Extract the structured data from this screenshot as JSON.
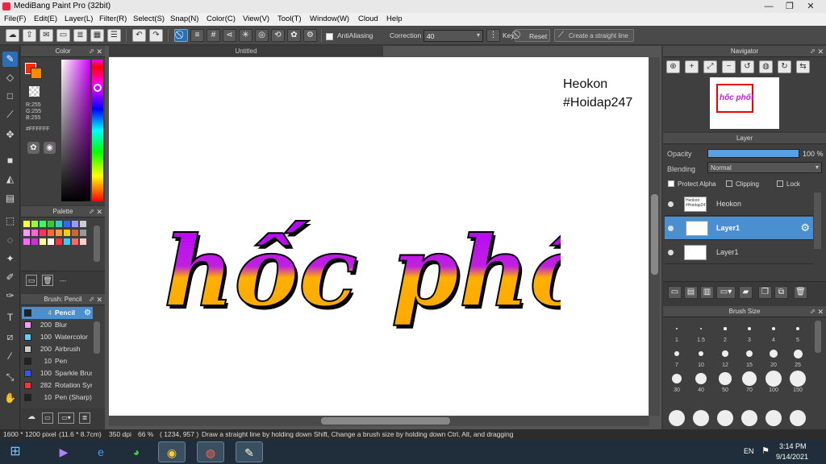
{
  "window": {
    "title": "MediBang Paint Pro (32bit)"
  },
  "menu": [
    "File(F)",
    "Edit(E)",
    "Layer(L)",
    "Filter(R)",
    "Select(S)",
    "Snap(N)",
    "Color(C)",
    "View(V)",
    "Tool(T)",
    "Window(W)",
    "Cloud",
    "Help"
  ],
  "toolbar": {
    "antialiasing_label": "AntiAliasing",
    "correction_label": "Correction",
    "correction_value": "40",
    "key_label": "Key",
    "reset_label": "Reset",
    "straight_line_label": "Create a straight line"
  },
  "color_panel": {
    "title": "Color",
    "r": "R:255",
    "g": "G:255",
    "b": "B:255",
    "hex": "#FFFFFF"
  },
  "palette_panel": {
    "title": "Palette",
    "footer": "---",
    "colors": [
      "#ffff33",
      "#99ff33",
      "#33ff66",
      "#33cc33",
      "#33cccc",
      "#3366ff",
      "#9999ff",
      "#cccccc",
      "#ff99ff",
      "#ff66cc",
      "#ff3366",
      "#ff6633",
      "#ff9933",
      "#ffcc00",
      "#cc6633",
      "#999999",
      "#ff66ff",
      "#cc33cc",
      "#ffff99",
      "#ffffff",
      "#ff3333",
      "#33ccff",
      "#ff6666",
      "#ffcccc"
    ]
  },
  "brush_panel": {
    "title": "Brush: Pencil",
    "brushes": [
      {
        "size": "4",
        "name": "Pencil",
        "color": "#222222"
      },
      {
        "size": "200",
        "name": "Blur",
        "color": "#ff99ff"
      },
      {
        "size": "100",
        "name": "Watercolor",
        "color": "#66ccff"
      },
      {
        "size": "200",
        "name": "Airbrush",
        "color": "#cccccc"
      },
      {
        "size": "10",
        "name": "Pen",
        "color": "#222222"
      },
      {
        "size": "100",
        "name": "Sparkle Brush",
        "color": "#3355ff"
      },
      {
        "size": "282",
        "name": "Rotation Symmetry",
        "color": "#ff3333"
      },
      {
        "size": "10",
        "name": "Pen (Sharp)",
        "color": "#222222"
      }
    ]
  },
  "document": {
    "tab": "Untitled",
    "text_top": "Heokon",
    "text_bottom": "#Hoidap247",
    "artwork_text": "hốc phốt"
  },
  "navigator": {
    "title": "Navigator",
    "thumb_text": "hốc phốt"
  },
  "layer_panel": {
    "title": "Layer",
    "opacity_label": "Opacity",
    "opacity_value": "100 %",
    "opacity": 1.0,
    "blending_label": "Blending",
    "blending_value": "Normal",
    "protect_alpha": "Protect Alpha",
    "clipping": "Clipping",
    "lock": "Lock",
    "layers": [
      {
        "name": "Heokon",
        "thumb": "Heokon #Hoidap247",
        "selected": false
      },
      {
        "name": "Layer1",
        "thumb": "",
        "selected": true
      },
      {
        "name": "Layer1",
        "thumb": "",
        "selected": false
      }
    ]
  },
  "brush_size_panel": {
    "title": "Brush Size",
    "sizes": [
      "1",
      "1.5",
      "2",
      "3",
      "4",
      "5",
      "7",
      "10",
      "12",
      "15",
      "20",
      "25",
      "30",
      "40",
      "50",
      "70",
      "100",
      "150"
    ]
  },
  "status": {
    "canvas_size": "1600 * 1200 pixel",
    "physical_size": "(11.6 * 8.7cm)",
    "dpi": "350 dpi",
    "zoom": "66 %",
    "coords": "( 1234, 957 )",
    "hint": "Draw a straight line by holding down Shift, Change a brush size by holding down Ctrl, Alt, and dragging"
  },
  "taskbar": {
    "language": "EN",
    "time": "3:14 PM",
    "date": "9/14/2021"
  }
}
